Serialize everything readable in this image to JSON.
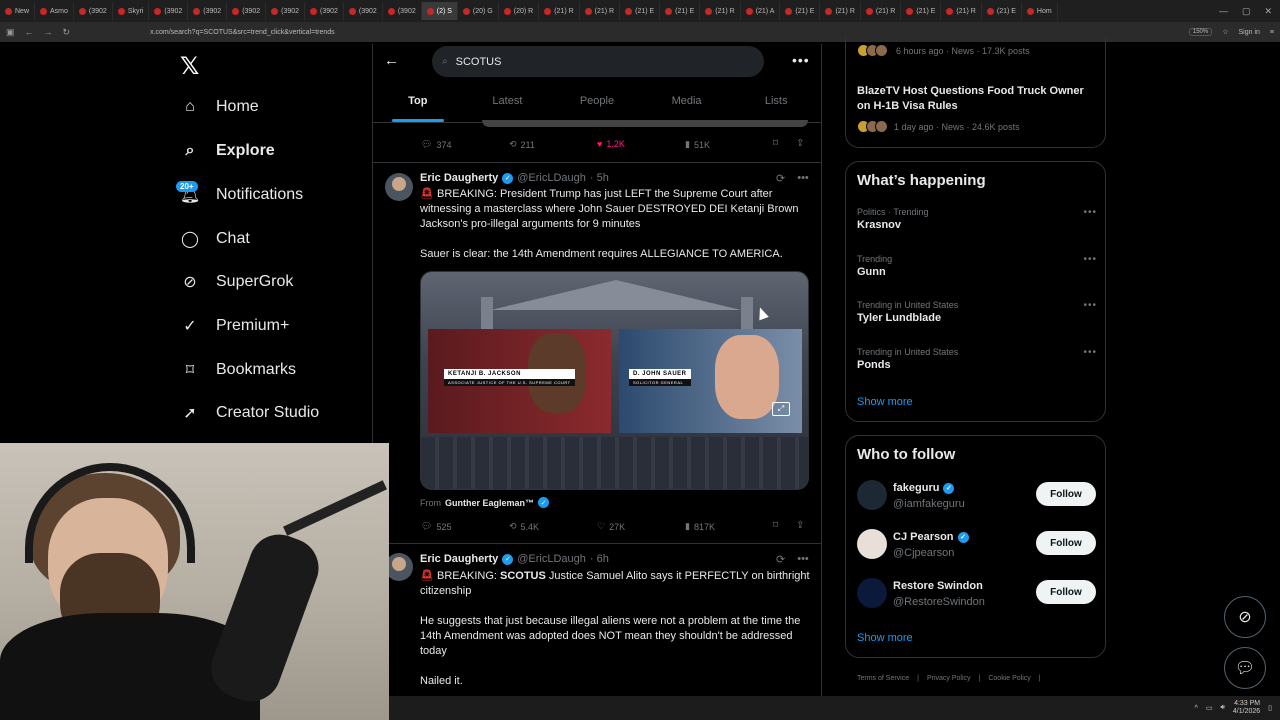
{
  "browser": {
    "tabs": [
      {
        "label": "New",
        "active": false
      },
      {
        "label": "Asmo",
        "active": false
      },
      {
        "label": "(3902",
        "active": false
      },
      {
        "label": "Skyri",
        "active": false
      },
      {
        "label": "(3902",
        "active": false
      },
      {
        "label": "(3902",
        "active": false
      },
      {
        "label": "(3902",
        "active": false
      },
      {
        "label": "(3902",
        "active": false
      },
      {
        "label": "(3902",
        "active": false
      },
      {
        "label": "(3902",
        "active": false
      },
      {
        "label": "(3902",
        "active": false
      },
      {
        "label": "(2) S",
        "active": true
      },
      {
        "label": "(20) G",
        "active": false
      },
      {
        "label": "(20) R",
        "active": false
      },
      {
        "label": "(21) R",
        "active": false
      },
      {
        "label": "(21) R",
        "active": false
      },
      {
        "label": "(21) E",
        "active": false
      },
      {
        "label": "(21) E",
        "active": false
      },
      {
        "label": "(21) R",
        "active": false
      },
      {
        "label": "(21) A",
        "active": false
      },
      {
        "label": "(21) E",
        "active": false
      },
      {
        "label": "(21) R",
        "active": false
      },
      {
        "label": "(21) R",
        "active": false
      },
      {
        "label": "(21) E",
        "active": false
      },
      {
        "label": "(21) R",
        "active": false
      },
      {
        "label": "(21) E",
        "active": false
      },
      {
        "label": "Hom",
        "active": false
      }
    ],
    "url": "x.com/search?q=SCOTUS&src=trend_click&vertical=trends",
    "zoom": "150%",
    "signin": "Sign in"
  },
  "nav": {
    "items": [
      {
        "key": "home",
        "label": "Home",
        "icon": "home-icon",
        "bold": false
      },
      {
        "key": "explore",
        "label": "Explore",
        "icon": "search-icon",
        "bold": true
      },
      {
        "key": "notifications",
        "label": "Notifications",
        "icon": "bell-icon",
        "bold": false
      },
      {
        "key": "chat",
        "label": "Chat",
        "icon": "chat-icon",
        "bold": false
      },
      {
        "key": "supergrok",
        "label": "SuperGrok",
        "icon": "grok-icon",
        "bold": false
      },
      {
        "key": "premium",
        "label": "Premium+",
        "icon": "verified-badge-icon",
        "bold": false
      },
      {
        "key": "bookmarks",
        "label": "Bookmarks",
        "icon": "bookmark-icon",
        "bold": false
      },
      {
        "key": "creator",
        "label": "Creator Studio",
        "icon": "rocket-icon",
        "bold": false
      }
    ],
    "notif_badge": "20+"
  },
  "search": {
    "query": "SCOTUS",
    "tabs": [
      "Top",
      "Latest",
      "People",
      "Media",
      "Lists"
    ],
    "active_tab": "Top"
  },
  "prev_tweet_actions": {
    "replies": "374",
    "reposts": "211",
    "likes": "1.2K",
    "views": "51K"
  },
  "tweets": [
    {
      "name": "Eric Daugherty",
      "handle": "@EricLDaugh",
      "time": "· 5h",
      "line1": "BREAKING: President Trump has just LEFT the Supreme Court after witnessing a masterclass where John Sauer DESTROYED DEI Ketanji Brown Jackson's pro-illegal arguments for 9 minutes",
      "line2": "Sauer is clear: the 14th Amendment requires ALLEGIANCE TO AMERICA.",
      "media": {
        "left_name": "KETANJI B. JACKSON",
        "left_title": "ASSOCIATE JUSTICE OF THE U.S. SUPREME COURT",
        "right_name": "D. JOHN SAUER",
        "right_title": "SOLICITOR GENERAL"
      },
      "from_prefix": "From",
      "from": "Gunther Eagleman™",
      "replies": "525",
      "reposts": "5.4K",
      "likes": "27K",
      "views": "817K"
    },
    {
      "name": "Eric Daugherty",
      "handle": "@EricLDaugh",
      "time": "· 6h",
      "line1_prefix": "BREAKING:",
      "line1_bold": "SCOTUS",
      "line1_rest": "Justice Samuel Alito says it PERFECTLY on birthright citizenship",
      "line2": "He suggests that just because illegal aliens were not a problem at the time the 14th Amendment was adopted does NOT mean they shouldn't be addressed today",
      "line3": "Nailed it."
    }
  ],
  "right": {
    "news": [
      {
        "meta": "6 hours ago · News · 17.3K posts"
      },
      {
        "title": "BlazeTV Host Questions Food Truck Owner on H-1B Visa Rules",
        "meta": "1 day ago · News · 24.6K posts"
      }
    ],
    "happening": {
      "title": "What’s happening",
      "trends": [
        {
          "meta": "Politics · Trending",
          "name": "Krasnov"
        },
        {
          "meta": "Trending",
          "name": "Gunn"
        },
        {
          "meta": "Trending in United States",
          "name": "Tyler Lundblade"
        },
        {
          "meta": "Trending in United States",
          "name": "Ponds"
        }
      ],
      "show_more": "Show more"
    },
    "who_to_follow": {
      "title": "Who to follow",
      "accounts": [
        {
          "name": "fakeguru",
          "handle": "@iamfakeguru",
          "button": "Follow"
        },
        {
          "name": "CJ Pearson",
          "handle": "@Cjpearson",
          "button": "Follow"
        },
        {
          "name": "Restore Swindon",
          "handle": "@RestoreSwindon",
          "button": "Follow"
        }
      ],
      "show_more": "Show more"
    },
    "footer": [
      "Terms of Service",
      "|",
      "Privacy Policy",
      "|",
      "Cookie Policy",
      "|"
    ]
  },
  "taskbar": {
    "time": "4:33 PM",
    "date": "4/1/2026"
  },
  "colors": {
    "accent": "#1d9bf0",
    "like": "#f91880",
    "background": "#000000"
  }
}
